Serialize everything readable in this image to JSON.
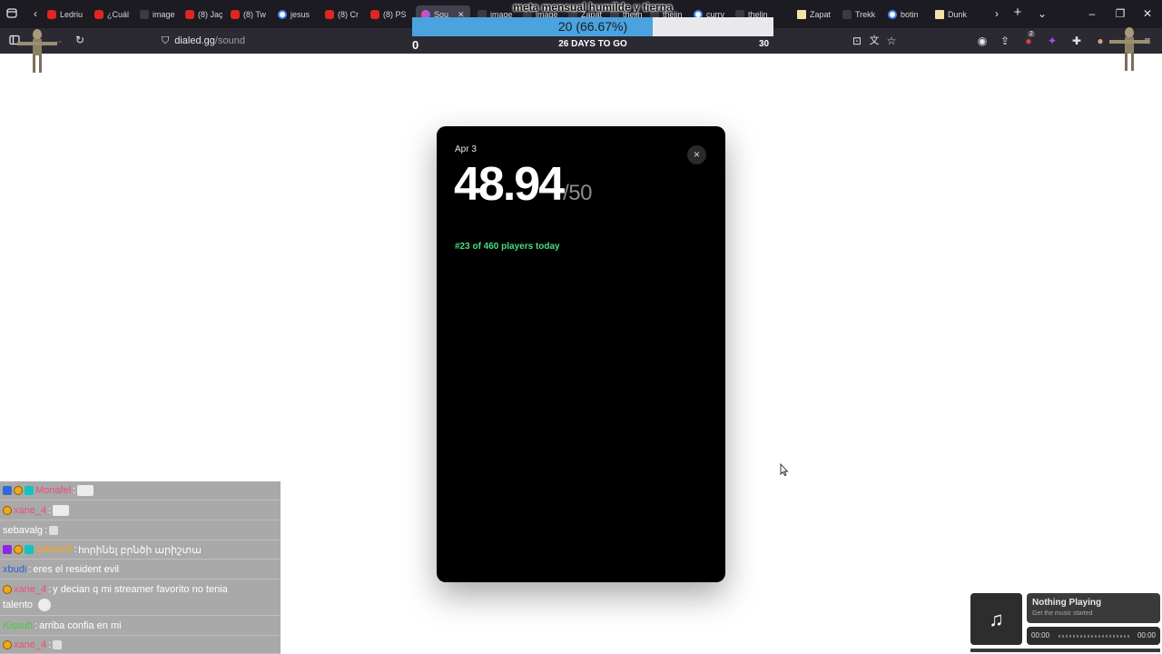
{
  "browser": {
    "tabs": [
      {
        "label": "Ledriu",
        "icon": "youtube-icon"
      },
      {
        "label": "¿Cuál",
        "icon": "youtube-icon"
      },
      {
        "label": "image",
        "icon": "page-icon"
      },
      {
        "label": "(8) Jaç",
        "icon": "youtube-icon"
      },
      {
        "label": "(8) Tw",
        "icon": "youtube-icon"
      },
      {
        "label": "jesus",
        "icon": "google-icon"
      },
      {
        "label": "(8) Cr",
        "icon": "youtube-icon"
      },
      {
        "label": "(8) PS",
        "icon": "youtube-icon"
      },
      {
        "label": "Sou",
        "icon": "dialed-icon"
      },
      {
        "label": "image",
        "icon": "page-icon"
      },
      {
        "label": "image",
        "icon": "page-icon"
      },
      {
        "label": "Zapat",
        "icon": "page-icon"
      },
      {
        "label": "thelin",
        "icon": "page-icon"
      },
      {
        "label": "thelin",
        "icon": "page-icon"
      },
      {
        "label": "curry",
        "icon": "google-icon"
      },
      {
        "label": "thelin",
        "icon": "page-icon"
      },
      {
        "label": "Zapat",
        "icon": "note-icon"
      },
      {
        "label": "Trekk",
        "icon": "page-icon"
      },
      {
        "label": "botin",
        "icon": "google-icon"
      },
      {
        "label": "Dunk",
        "icon": "note-icon"
      }
    ],
    "url_domain": "dialed.gg",
    "url_path": "/sound",
    "notification_count": "2"
  },
  "goal": {
    "title": "meta mensual humilde y tierna",
    "current": 20,
    "target": 30,
    "progress_text": "20 (66.67%)",
    "progress_fraction": 0.6667,
    "min_label": "0",
    "days_label": "26 DAYS TO GO",
    "max_label": "30",
    "fill_color": "#4aa3df"
  },
  "modal": {
    "date": "Apr 3",
    "score": "48.94",
    "score_max": "/50",
    "rank_text": "#23 of 460 players today",
    "rank_color": "#4ade80",
    "close_label": "×"
  },
  "chat": {
    "messages": [
      {
        "user": "Monafel",
        "user_color": "#e94f7b",
        "text": "",
        "badges": [
          "prime",
          "gold",
          "cyan"
        ],
        "emote": "wide"
      },
      {
        "user": "xane_4",
        "user_color": "#e94f7b",
        "text": "",
        "badges": [
          "gold"
        ],
        "emote": "wide"
      },
      {
        "user": "sebavalg",
        "user_color": "#ffffff",
        "text": "",
        "badges": [],
        "emote": "tiny"
      },
      {
        "user": "safewolf",
        "user_color": "#f5a623",
        "text": "hnրինել բրնծի արիշտա",
        "badges": [
          "purple",
          "gold",
          "cyan"
        ],
        "emote": ""
      },
      {
        "user": "xbudi",
        "user_color": "#2f5fd8",
        "text": "eres el resident evil",
        "badges": [],
        "emote": ""
      },
      {
        "user": "xane_4",
        "user_color": "#e94f7b",
        "text": "y decian q mi streamer favorito no tenia",
        "text2": "talento",
        "badges": [
          "gold"
        ],
        "emote": "face"
      },
      {
        "user": "Kissuh",
        "user_color": "#3ecf3e",
        "text": "arriba confia en mi",
        "badges": [],
        "emote": ""
      },
      {
        "user": "xane_4",
        "user_color": "#e94f7b",
        "text": "",
        "badges": [
          "gold"
        ],
        "emote": "tiny"
      }
    ]
  },
  "now_playing": {
    "title": "Nothing Playing",
    "subtitle": "Get the music started",
    "current_time": "00:00",
    "duration": "00:00",
    "icon": "music-note-icon"
  }
}
